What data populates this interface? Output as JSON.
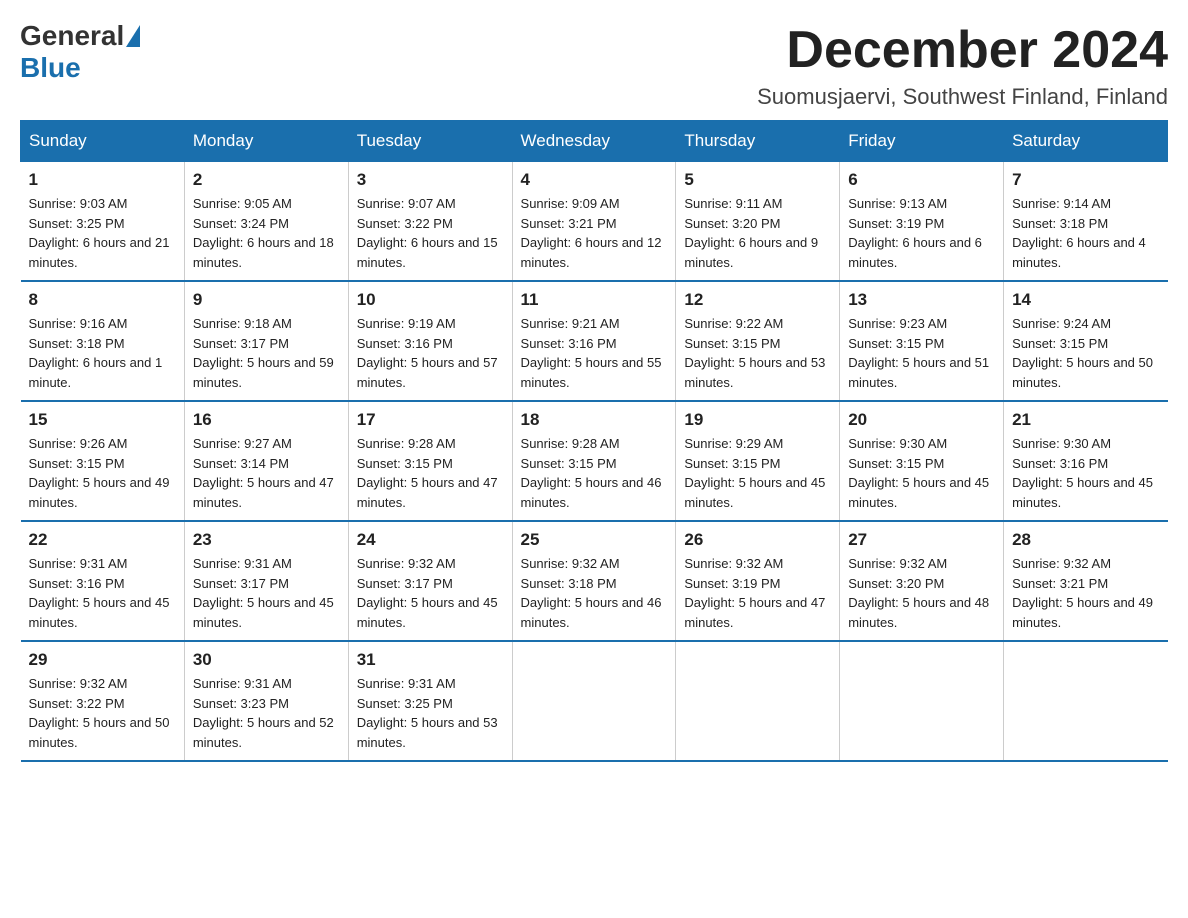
{
  "header": {
    "logo_general": "General",
    "logo_blue": "Blue",
    "month_title": "December 2024",
    "location": "Suomusjaervi, Southwest Finland, Finland"
  },
  "weekdays": [
    "Sunday",
    "Monday",
    "Tuesday",
    "Wednesday",
    "Thursday",
    "Friday",
    "Saturday"
  ],
  "weeks": [
    [
      {
        "day": "1",
        "sunrise": "9:03 AM",
        "sunset": "3:25 PM",
        "daylight": "6 hours and 21 minutes."
      },
      {
        "day": "2",
        "sunrise": "9:05 AM",
        "sunset": "3:24 PM",
        "daylight": "6 hours and 18 minutes."
      },
      {
        "day": "3",
        "sunrise": "9:07 AM",
        "sunset": "3:22 PM",
        "daylight": "6 hours and 15 minutes."
      },
      {
        "day": "4",
        "sunrise": "9:09 AM",
        "sunset": "3:21 PM",
        "daylight": "6 hours and 12 minutes."
      },
      {
        "day": "5",
        "sunrise": "9:11 AM",
        "sunset": "3:20 PM",
        "daylight": "6 hours and 9 minutes."
      },
      {
        "day": "6",
        "sunrise": "9:13 AM",
        "sunset": "3:19 PM",
        "daylight": "6 hours and 6 minutes."
      },
      {
        "day": "7",
        "sunrise": "9:14 AM",
        "sunset": "3:18 PM",
        "daylight": "6 hours and 4 minutes."
      }
    ],
    [
      {
        "day": "8",
        "sunrise": "9:16 AM",
        "sunset": "3:18 PM",
        "daylight": "6 hours and 1 minute."
      },
      {
        "day": "9",
        "sunrise": "9:18 AM",
        "sunset": "3:17 PM",
        "daylight": "5 hours and 59 minutes."
      },
      {
        "day": "10",
        "sunrise": "9:19 AM",
        "sunset": "3:16 PM",
        "daylight": "5 hours and 57 minutes."
      },
      {
        "day": "11",
        "sunrise": "9:21 AM",
        "sunset": "3:16 PM",
        "daylight": "5 hours and 55 minutes."
      },
      {
        "day": "12",
        "sunrise": "9:22 AM",
        "sunset": "3:15 PM",
        "daylight": "5 hours and 53 minutes."
      },
      {
        "day": "13",
        "sunrise": "9:23 AM",
        "sunset": "3:15 PM",
        "daylight": "5 hours and 51 minutes."
      },
      {
        "day": "14",
        "sunrise": "9:24 AM",
        "sunset": "3:15 PM",
        "daylight": "5 hours and 50 minutes."
      }
    ],
    [
      {
        "day": "15",
        "sunrise": "9:26 AM",
        "sunset": "3:15 PM",
        "daylight": "5 hours and 49 minutes."
      },
      {
        "day": "16",
        "sunrise": "9:27 AM",
        "sunset": "3:14 PM",
        "daylight": "5 hours and 47 minutes."
      },
      {
        "day": "17",
        "sunrise": "9:28 AM",
        "sunset": "3:15 PM",
        "daylight": "5 hours and 47 minutes."
      },
      {
        "day": "18",
        "sunrise": "9:28 AM",
        "sunset": "3:15 PM",
        "daylight": "5 hours and 46 minutes."
      },
      {
        "day": "19",
        "sunrise": "9:29 AM",
        "sunset": "3:15 PM",
        "daylight": "5 hours and 45 minutes."
      },
      {
        "day": "20",
        "sunrise": "9:30 AM",
        "sunset": "3:15 PM",
        "daylight": "5 hours and 45 minutes."
      },
      {
        "day": "21",
        "sunrise": "9:30 AM",
        "sunset": "3:16 PM",
        "daylight": "5 hours and 45 minutes."
      }
    ],
    [
      {
        "day": "22",
        "sunrise": "9:31 AM",
        "sunset": "3:16 PM",
        "daylight": "5 hours and 45 minutes."
      },
      {
        "day": "23",
        "sunrise": "9:31 AM",
        "sunset": "3:17 PM",
        "daylight": "5 hours and 45 minutes."
      },
      {
        "day": "24",
        "sunrise": "9:32 AM",
        "sunset": "3:17 PM",
        "daylight": "5 hours and 45 minutes."
      },
      {
        "day": "25",
        "sunrise": "9:32 AM",
        "sunset": "3:18 PM",
        "daylight": "5 hours and 46 minutes."
      },
      {
        "day": "26",
        "sunrise": "9:32 AM",
        "sunset": "3:19 PM",
        "daylight": "5 hours and 47 minutes."
      },
      {
        "day": "27",
        "sunrise": "9:32 AM",
        "sunset": "3:20 PM",
        "daylight": "5 hours and 48 minutes."
      },
      {
        "day": "28",
        "sunrise": "9:32 AM",
        "sunset": "3:21 PM",
        "daylight": "5 hours and 49 minutes."
      }
    ],
    [
      {
        "day": "29",
        "sunrise": "9:32 AM",
        "sunset": "3:22 PM",
        "daylight": "5 hours and 50 minutes."
      },
      {
        "day": "30",
        "sunrise": "9:31 AM",
        "sunset": "3:23 PM",
        "daylight": "5 hours and 52 minutes."
      },
      {
        "day": "31",
        "sunrise": "9:31 AM",
        "sunset": "3:25 PM",
        "daylight": "5 hours and 53 minutes."
      },
      null,
      null,
      null,
      null
    ]
  ],
  "labels": {
    "sunrise_prefix": "Sunrise: ",
    "sunset_prefix": "Sunset: ",
    "daylight_prefix": "Daylight: "
  }
}
